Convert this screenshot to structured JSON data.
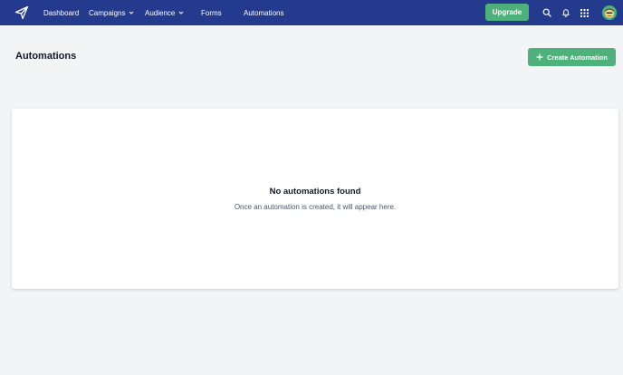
{
  "nav": {
    "items": [
      {
        "label": "Dashboard",
        "has_dropdown": false
      },
      {
        "label": "Campaigns",
        "has_dropdown": true
      },
      {
        "label": "Audience",
        "has_dropdown": true
      },
      {
        "label": "Forms",
        "has_dropdown": false
      },
      {
        "label": "Automations",
        "has_dropdown": false
      }
    ],
    "upgrade_label": "Upgrade",
    "icons": [
      "search-icon",
      "bell-icon",
      "apps-grid-icon"
    ]
  },
  "page": {
    "title": "Automations",
    "create_button_label": "Create Automation"
  },
  "empty_state": {
    "title": "No automations found",
    "description": "Once an automation is created, it will appear here."
  },
  "colors": {
    "navbar": "#243a8c",
    "accent_green": "#4eb07a",
    "background": "#f3f4f6"
  }
}
